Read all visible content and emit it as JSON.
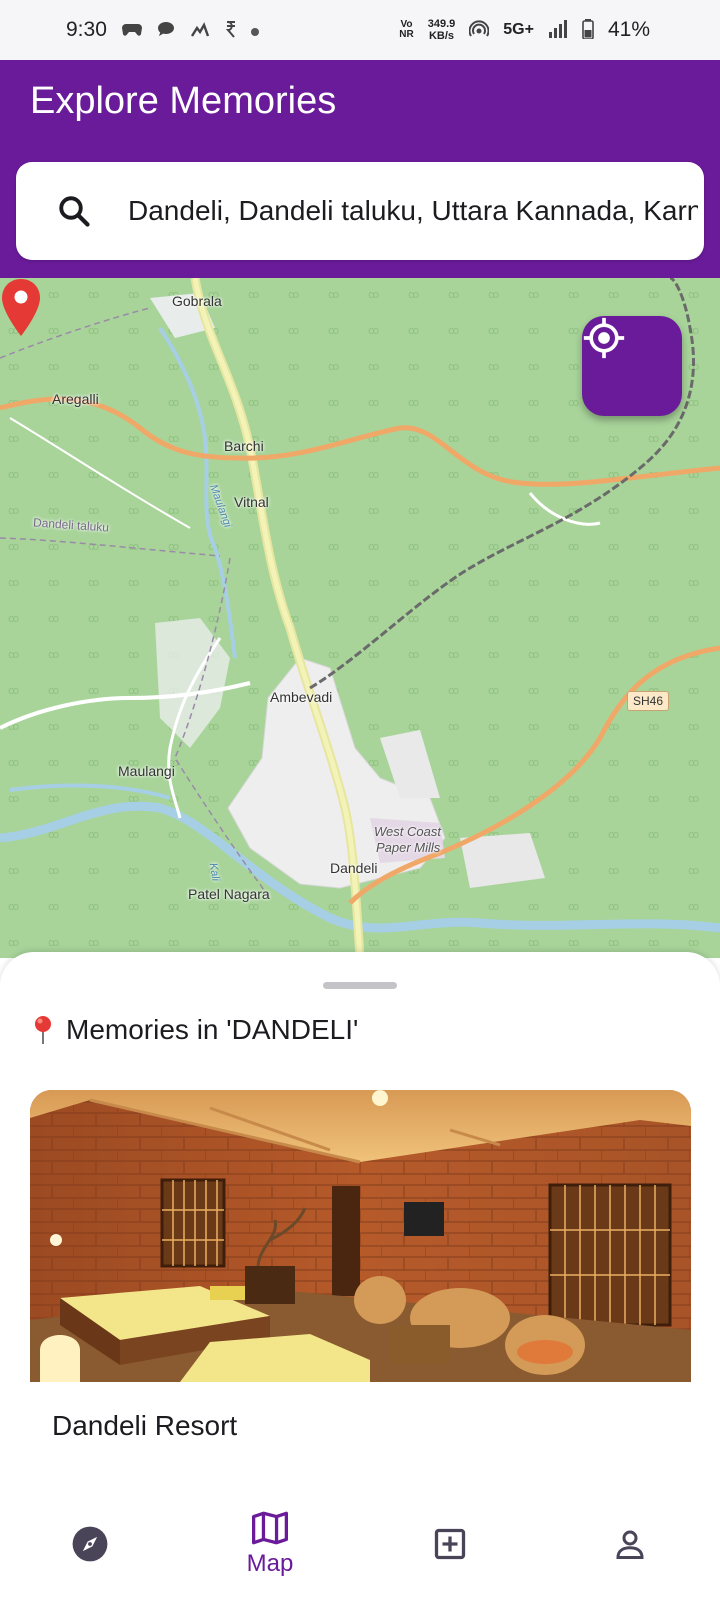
{
  "status_bar": {
    "time": "9:30",
    "network_top": "Vo",
    "network_bottom": "NR",
    "speed_value": "349.9",
    "speed_unit": "KB/s",
    "network_type": "5G+",
    "battery": "41%"
  },
  "app_bar": {
    "title": "Explore Memories"
  },
  "search": {
    "value": "Dandeli, Dandeli taluku, Uttara Kannada, Karnataka",
    "icon": "search-icon"
  },
  "map": {
    "labels": {
      "gobrala": "Gobrala",
      "aregalli": "Aregalli",
      "barchi": "Barchi",
      "vitnal": "Vitnal",
      "dandeli_taluku": "Dandeli taluku",
      "maulangi_river": "Maulangi",
      "ambevadi": "Ambevadi",
      "maulangi": "Maulangi",
      "west_coast_1": "West Coast",
      "west_coast_2": "Paper Mills",
      "dandeli": "Dandeli",
      "patel_nagara": "Patel Nagara",
      "kali_river": "Kali"
    },
    "road_badge": "SH46",
    "locate_icon": "my-location-icon",
    "pin_color": "#e53935"
  },
  "sheet": {
    "header": "Memories in 'DANDELI'",
    "memories": [
      {
        "title": "Dandeli Resort"
      }
    ]
  },
  "nav": {
    "items": [
      {
        "icon": "explore-icon",
        "label": ""
      },
      {
        "icon": "map-icon",
        "label": "Map",
        "active": true
      },
      {
        "icon": "add-box-icon",
        "label": ""
      },
      {
        "icon": "person-icon",
        "label": ""
      }
    ]
  },
  "colors": {
    "primary": "#6a1b9a",
    "map_green": "#a8d49a",
    "road_orange": "#f0a868",
    "river": "#a6cfe6"
  }
}
